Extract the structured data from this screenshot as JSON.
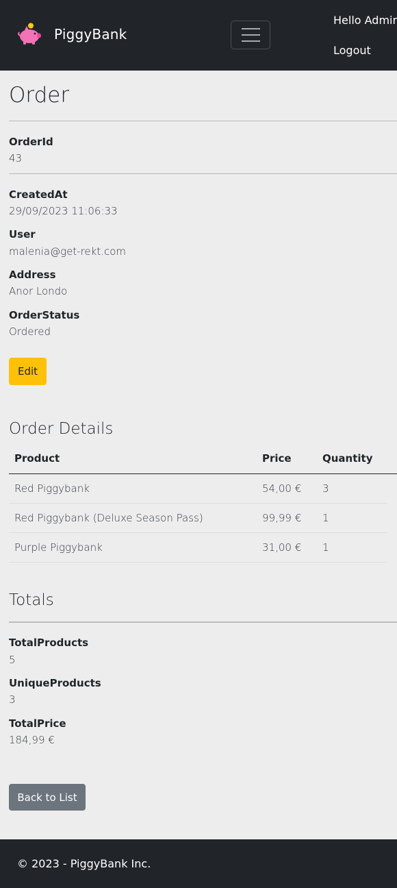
{
  "navbar": {
    "brand": "PiggyBank",
    "logo_icon": "piggy-bank-icon",
    "menu_icon": "hamburger-menu-icon",
    "greeting": "Hello Admin",
    "logout": "Logout",
    "colors": {
      "background": "#212529",
      "logo_pink": "#f472b6",
      "coin": "#facc15"
    }
  },
  "order": {
    "title": "Order",
    "fields": [
      {
        "label": "OrderId",
        "value": "43"
      },
      {
        "label": "CreatedAt",
        "value": "29/09/2023 11:06:33"
      },
      {
        "label": "User",
        "value": "malenia@get-rekt.com"
      },
      {
        "label": "Address",
        "value": "Anor Londo"
      },
      {
        "label": "OrderStatus",
        "value": "Ordered"
      }
    ],
    "edit_label": "Edit"
  },
  "details": {
    "title": "Order Details",
    "columns": [
      "Product",
      "Price",
      "Quantity"
    ],
    "rows": [
      [
        "Red Piggybank",
        "54,00 €",
        "3"
      ],
      [
        "Red Piggybank (Deluxe Season Pass)",
        "99,99 €",
        "1"
      ],
      [
        "Purple Piggybank",
        "31,00 €",
        "1"
      ]
    ]
  },
  "totals": {
    "title": "Totals",
    "fields": [
      {
        "label": "TotalProducts",
        "value": "5"
      },
      {
        "label": "UniqueProducts",
        "value": "3"
      },
      {
        "label": "TotalPrice",
        "value": "184,99 €"
      }
    ]
  },
  "back_label": "Back to List",
  "footer": {
    "text": "© 2023 - PiggyBank Inc."
  },
  "colors": {
    "page_bg": "#ededed",
    "edit_button": "#ffc107",
    "back_button": "#6c757d"
  }
}
